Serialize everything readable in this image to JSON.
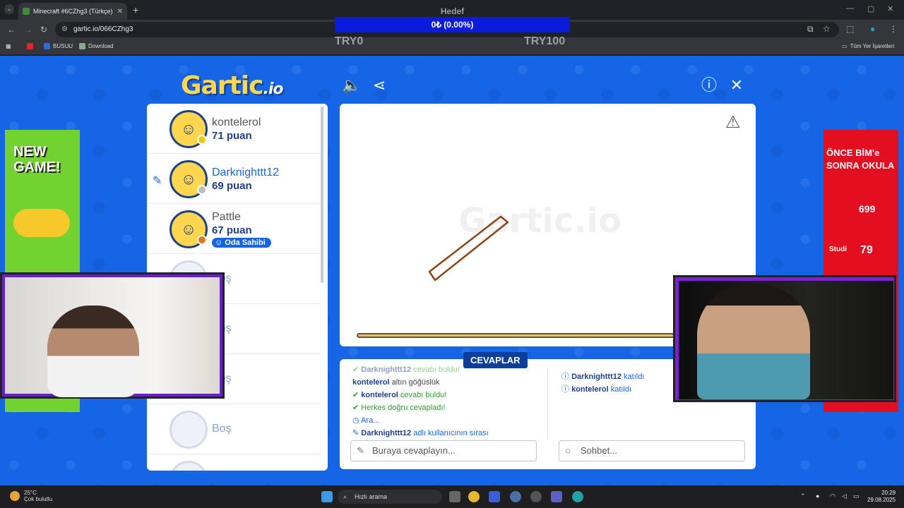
{
  "browser": {
    "tab_title": "Minecraft #6CZhg3 (Türkçe) - G",
    "url": "gartic.io/066CZhg3",
    "bookmarks": [
      "BUSUU",
      "Download"
    ],
    "all_bookmarks": "Tüm Yer İşaretleri"
  },
  "goal": {
    "label": "Hedef",
    "value_text": "0₺ (0.00%)",
    "progress_fraction": 0.0,
    "min": "TRY0",
    "max": "TRY100"
  },
  "game": {
    "logo": "Gartic",
    "logo_suffix": ".io",
    "players": [
      {
        "name": "kontelerol",
        "score": "71 puan",
        "status_color": "#f5c518"
      },
      {
        "name": "Darknighttt12",
        "score": "69 puan",
        "status_color": "#bdbdbd",
        "drawing": true
      },
      {
        "name": "Pattle",
        "score": "67 puan",
        "status_color": "#e8711c",
        "badge": "Oda Sahibi"
      }
    ],
    "empty_slot": "Boş",
    "answers_tag": "CEVAPLAR",
    "answers": [
      {
        "user": "Darknighttt12",
        "text": "cevabı buldu!"
      },
      {
        "user": "kontelerol",
        "text": "altın göğüslük"
      },
      {
        "user": "kontelerol",
        "text": "cevabı buldu!"
      },
      {
        "text": "Herkes doğru cevapladı!"
      },
      {
        "text": "Ara..."
      },
      {
        "user": "Darknighttt12",
        "text": "adlı kullanıcının sırası"
      }
    ],
    "chat": [
      {
        "user": "Darknighttt12",
        "text": "katıldı"
      },
      {
        "user": "kontelerol",
        "text": "katıldı"
      }
    ],
    "answer_placeholder": "Buraya cevaplayın...",
    "chat_placeholder": "Sohbet...",
    "timer_fraction": 1.0
  },
  "ads": {
    "left_text": "NEW GAME!",
    "right_text": "ÖNCE BİM'e SONRA OKULA",
    "right_price1": "699",
    "right_price2": "79",
    "right_brand": "Studi"
  },
  "taskbar": {
    "temp": "25°C",
    "weather": "Çok bulutlu",
    "search": "Hızlı arama",
    "time": "20:29",
    "date": "29.08.2025"
  }
}
